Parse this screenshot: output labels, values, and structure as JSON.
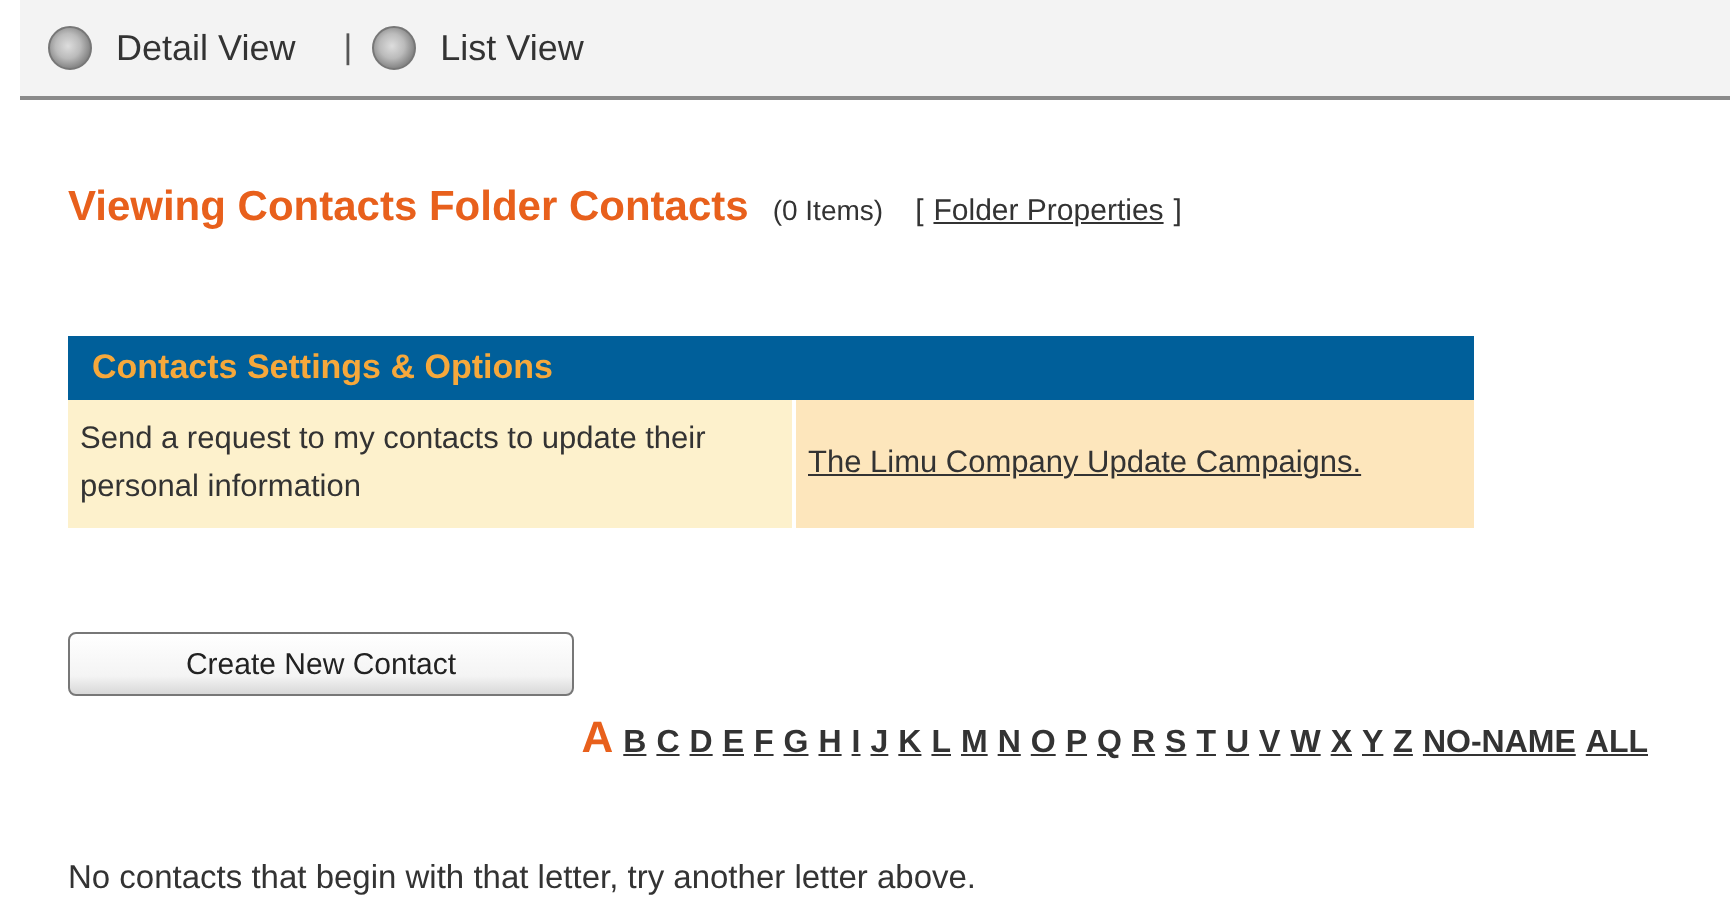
{
  "view_toolbar": {
    "options": [
      {
        "label": "Detail View",
        "selected": false
      },
      {
        "label": "List View",
        "selected": false
      }
    ],
    "separator": "|"
  },
  "heading": {
    "title": "Viewing Contacts Folder Contacts",
    "count": "(0 Items)",
    "link_open": "[",
    "link": "Folder Properties",
    "link_close": "]"
  },
  "settings_panel": {
    "title": "Contacts Settings & Options",
    "rows": [
      {
        "description": "Send a request to my contacts to update their personal information",
        "link": "The Limu Company Update Campaigns."
      }
    ]
  },
  "create_button": "Create New Contact",
  "letters": [
    {
      "label": "A",
      "selected": true
    },
    {
      "label": "B",
      "selected": false
    },
    {
      "label": "C",
      "selected": false
    },
    {
      "label": "D",
      "selected": false
    },
    {
      "label": "E",
      "selected": false
    },
    {
      "label": "F",
      "selected": false
    },
    {
      "label": "G",
      "selected": false
    },
    {
      "label": "H",
      "selected": false
    },
    {
      "label": "I",
      "selected": false
    },
    {
      "label": "J",
      "selected": false
    },
    {
      "label": "K",
      "selected": false
    },
    {
      "label": "L",
      "selected": false
    },
    {
      "label": "M",
      "selected": false
    },
    {
      "label": "N",
      "selected": false
    },
    {
      "label": "O",
      "selected": false
    },
    {
      "label": "P",
      "selected": false
    },
    {
      "label": "Q",
      "selected": false
    },
    {
      "label": "R",
      "selected": false
    },
    {
      "label": "S",
      "selected": false
    },
    {
      "label": "T",
      "selected": false
    },
    {
      "label": "U",
      "selected": false
    },
    {
      "label": "V",
      "selected": false
    },
    {
      "label": "W",
      "selected": false
    },
    {
      "label": "X",
      "selected": false
    },
    {
      "label": "Y",
      "selected": false
    },
    {
      "label": "Z",
      "selected": false
    },
    {
      "label": "NO-NAME",
      "selected": false
    },
    {
      "label": "ALL",
      "selected": false
    }
  ],
  "message": "No contacts that begin with that letter, try another letter above."
}
